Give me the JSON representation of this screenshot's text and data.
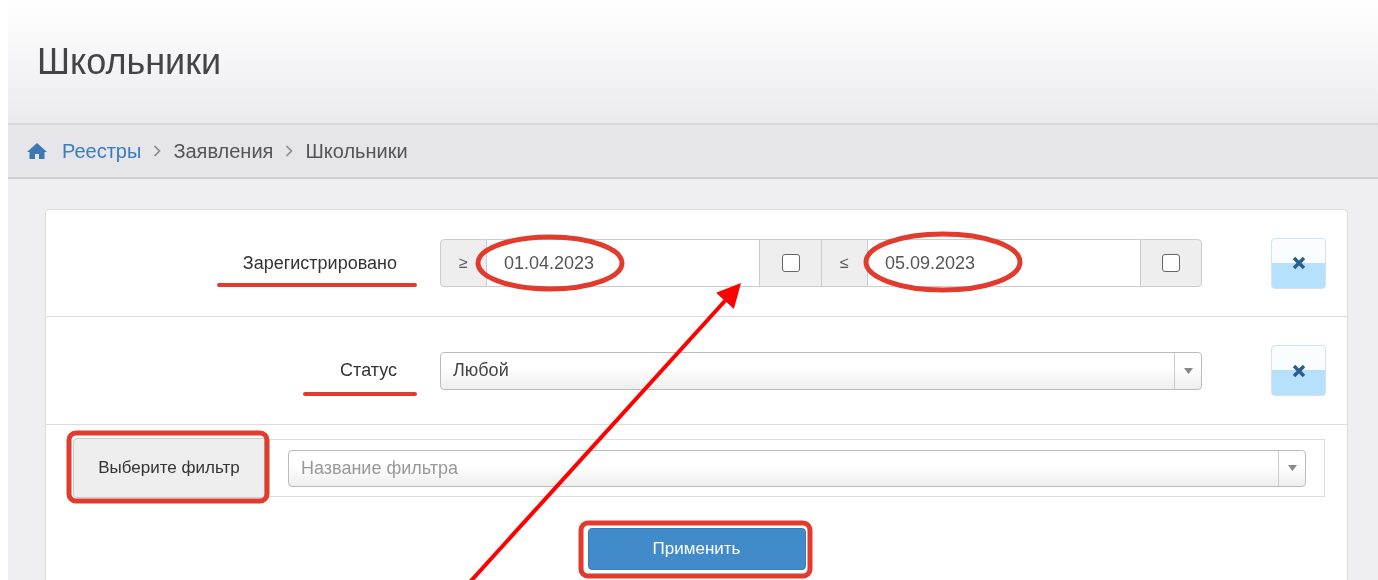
{
  "page_title": "Школьники",
  "breadcrumb": [
    {
      "label": "Реестры",
      "kind": "link"
    },
    {
      "label": "Заявления",
      "kind": "text"
    },
    {
      "label": "Школьники",
      "kind": "text"
    }
  ],
  "filters": [
    {
      "kind": "date_range",
      "label": "Зарегистрировано",
      "from": {
        "operator": "≥",
        "value": "01.04.2023",
        "checked": false
      },
      "to": {
        "operator": "≤",
        "value": "05.09.2023",
        "checked": false
      }
    },
    {
      "kind": "select",
      "label": "Статус",
      "value": "Любой"
    }
  ],
  "filter_picker": {
    "button": "Выберите фильтр",
    "placeholder": "Название фильтра"
  },
  "apply_button": "Применить"
}
